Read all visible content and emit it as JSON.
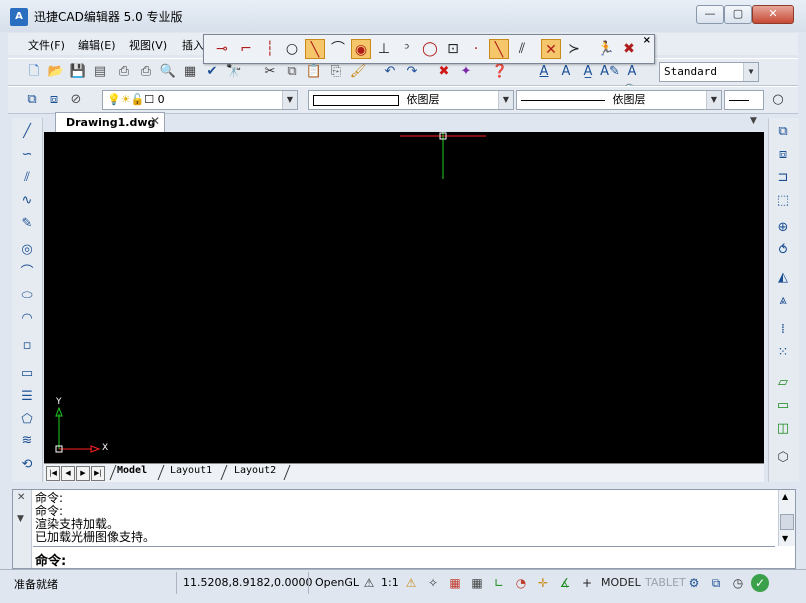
{
  "window": {
    "title": "迅捷CAD编辑器 5.0 专业版",
    "icon": "app-logo-icon",
    "controls": {
      "minimize": "—",
      "maximize": "▢",
      "close": "✕"
    }
  },
  "menu": {
    "items": [
      "文件(F)",
      "编辑(E)",
      "视图(V)",
      "插入"
    ]
  },
  "snap_toolbar": {
    "close": "×",
    "icons": [
      "snap-endpoint-icon",
      "snap-midpoint-icon",
      "snap-intersection-icon",
      "snap-circle-icon",
      "snap-line-icon",
      "snap-tangent-icon",
      "snap-center-icon",
      "snap-perpendicular-icon",
      "snap-arc-icon",
      "snap-quadrant-icon",
      "snap-block-icon",
      "snap-node-icon",
      "snap-extension-icon",
      "snap-parallel-icon",
      "snap-clear-icon",
      "snap-track-icon",
      "snap-off-icon"
    ]
  },
  "toolbar1": {
    "text_style": "Standard"
  },
  "toolbar2": {
    "layer_value": "0",
    "linetype_value": "依图层",
    "lineweight_value": "依图层"
  },
  "document": {
    "tab_label": "Drawing1.dwg",
    "tab_close": "✕"
  },
  "canvas": {
    "background": "#000000",
    "axis_x_label": "X",
    "axis_y_label": "Y",
    "axis_x_color": "#ff2020",
    "axis_y_color": "#20d020"
  },
  "layout_tabs": {
    "nav": [
      "|◀",
      "◀",
      "▶",
      "▶|"
    ],
    "tabs": [
      "Model",
      "Layout1",
      "Layout2"
    ]
  },
  "command": {
    "history": [
      "命令:",
      "命令:",
      "渲染支持加载。",
      "已加载光栅图像支持。"
    ],
    "prompt": "命令:"
  },
  "status": {
    "ready": "准备就绪",
    "coords": "11.5208,8.9182,0.0000",
    "renderer": "OpenGL",
    "scale": "1:1",
    "model": "MODEL",
    "tablet": "TABLET"
  }
}
